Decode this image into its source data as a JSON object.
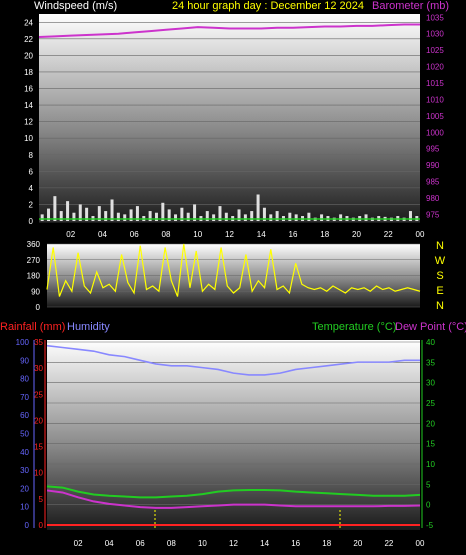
{
  "header": {
    "windspeed_label": "Windspeed (m/s)",
    "title": "24 hour graph day : December 12 2024",
    "barometer_label": "Barometer (mb)"
  },
  "mid_labels": {
    "compass": [
      "N",
      "W",
      "S",
      "E",
      "N"
    ]
  },
  "bottom_header": {
    "rainfall_label": "Rainfall (mm)",
    "humidity_label": "Humidity",
    "temperature_label": "Temperature (°C)",
    "dewpoint_label": "Dew Point (°C)"
  },
  "colors": {
    "windspeed": "#e0e0e0",
    "gust_baseline": "#22cc22",
    "barometer": "#cc33cc",
    "wind_direction": "#ffff00",
    "rainfall": "#ff2222",
    "humidity": "#8888ff",
    "temperature": "#22cc22",
    "dewpoint": "#cc33cc",
    "title": "#ffff00"
  },
  "chart_data": [
    {
      "type": "line",
      "title": "24 hour graph day : December 12 2024",
      "x_ticks": [
        "02",
        "04",
        "06",
        "08",
        "10",
        "12",
        "14",
        "16",
        "18",
        "20",
        "22",
        "00"
      ],
      "xlim": [
        0,
        24
      ],
      "left_axis": {
        "label": "Windspeed (m/s)",
        "ticks": [
          0,
          2,
          4,
          6,
          8,
          10,
          12,
          14,
          16,
          18,
          20,
          22,
          24
        ],
        "ylim": [
          0,
          25
        ]
      },
      "right_axis": {
        "label": "Barometer (mb)",
        "ticks": [
          975,
          980,
          985,
          990,
          995,
          1000,
          1005,
          1010,
          1015,
          1020,
          1025,
          1030,
          1035
        ],
        "ylim": [
          973,
          1036
        ]
      },
      "series": [
        {
          "name": "Windspeed (m/s)",
          "axis": "left",
          "style": "bars",
          "x": [
            0.2,
            0.6,
            1.0,
            1.4,
            1.8,
            2.2,
            2.6,
            3.0,
            3.4,
            3.8,
            4.2,
            4.6,
            5.0,
            5.4,
            5.8,
            6.2,
            6.6,
            7.0,
            7.4,
            7.8,
            8.2,
            8.6,
            9.0,
            9.4,
            9.8,
            10.2,
            10.6,
            11.0,
            11.4,
            11.8,
            12.2,
            12.6,
            13.0,
            13.4,
            13.8,
            14.2,
            14.6,
            15.0,
            15.4,
            15.8,
            16.2,
            16.6,
            17.0,
            17.4,
            17.8,
            18.2,
            18.6,
            19.0,
            19.4,
            19.8,
            20.2,
            20.6,
            21.0,
            21.4,
            21.8,
            22.2,
            22.6,
            23.0,
            23.4,
            23.8
          ],
          "values": [
            0.8,
            1.5,
            3.0,
            1.2,
            2.4,
            1.0,
            2.0,
            1.6,
            0.6,
            1.8,
            1.2,
            2.6,
            1.0,
            0.8,
            1.4,
            1.8,
            0.6,
            1.2,
            1.0,
            2.2,
            1.4,
            0.8,
            1.6,
            1.0,
            2.0,
            0.6,
            1.2,
            0.8,
            1.8,
            1.0,
            0.6,
            1.4,
            0.8,
            1.2,
            3.2,
            1.6,
            0.8,
            1.2,
            0.6,
            1.0,
            0.8,
            0.6,
            1.0,
            0.4,
            0.8,
            0.6,
            0.4,
            0.8,
            0.6,
            0.4,
            0.6,
            0.8,
            0.4,
            0.6,
            0.5,
            0.4,
            0.6,
            0.4,
            1.2,
            0.6
          ]
        },
        {
          "name": "Barometer (mb)",
          "axis": "right",
          "style": "line",
          "x": [
            0,
            1,
            2,
            3,
            4,
            5,
            6,
            7,
            8,
            9,
            10,
            11,
            12,
            13,
            14,
            15,
            16,
            17,
            18,
            19,
            20,
            21,
            22,
            23,
            24
          ],
          "values": [
            1029.0,
            1029.2,
            1029.4,
            1029.6,
            1029.8,
            1030.0,
            1030.4,
            1030.8,
            1031.2,
            1031.6,
            1032.0,
            1031.8,
            1031.6,
            1031.6,
            1031.6,
            1031.8,
            1031.8,
            1032.0,
            1032.2,
            1032.2,
            1032.4,
            1032.4,
            1032.6,
            1032.8,
            1032.8
          ]
        }
      ]
    },
    {
      "type": "line",
      "x_ticks": [
        "02",
        "04",
        "06",
        "08",
        "10",
        "12",
        "14",
        "16",
        "18",
        "20",
        "22",
        "00"
      ],
      "xlim": [
        0,
        24
      ],
      "left_axis": {
        "ticks": [
          0,
          90,
          180,
          270,
          360
        ],
        "ylim": [
          0,
          360
        ]
      },
      "right_labels": [
        "N",
        "W",
        "S",
        "E",
        "N"
      ],
      "series": [
        {
          "name": "Wind direction",
          "axis": "left",
          "style": "line",
          "x": [
            0,
            0.4,
            0.8,
            1.2,
            1.6,
            2.0,
            2.4,
            2.8,
            3.2,
            3.6,
            4.0,
            4.4,
            4.8,
            5.2,
            5.6,
            6.0,
            6.4,
            6.8,
            7.2,
            7.6,
            8.0,
            8.4,
            8.8,
            9.2,
            9.6,
            10.0,
            10.4,
            10.8,
            11.2,
            11.6,
            12.0,
            12.4,
            12.8,
            13.2,
            13.6,
            14.0,
            14.4,
            14.8,
            15.2,
            15.6,
            16.0,
            16.4,
            16.8,
            17.2,
            17.6,
            18.0,
            18.4,
            18.8,
            19.2,
            19.6,
            20.0,
            20.4,
            20.8,
            21.2,
            21.6,
            22.0,
            22.4,
            22.8,
            23.2,
            23.6,
            24.0
          ],
          "values": [
            100,
            340,
            60,
            150,
            90,
            310,
            120,
            80,
            200,
            110,
            130,
            90,
            300,
            140,
            80,
            350,
            100,
            120,
            90,
            340,
            150,
            60,
            360,
            110,
            320,
            90,
            130,
            100,
            340,
            120,
            80,
            110,
            300,
            90,
            150,
            110,
            330,
            100,
            120,
            80,
            250,
            130,
            110,
            100,
            110,
            90,
            120,
            100,
            80,
            110,
            100,
            110,
            90,
            120,
            100,
            110,
            90,
            100,
            110,
            100,
            90
          ]
        }
      ]
    },
    {
      "type": "line",
      "x_ticks": [
        "02",
        "04",
        "06",
        "08",
        "10",
        "12",
        "14",
        "16",
        "18",
        "20",
        "22",
        "00"
      ],
      "xlim": [
        0,
        24
      ],
      "far_left_axis": {
        "label": "Humidity",
        "ticks": [
          0,
          10,
          20,
          30,
          40,
          50,
          60,
          70,
          80,
          90,
          100
        ],
        "ylim": [
          0,
          100
        ]
      },
      "left_axis": {
        "label": "Rainfall (mm)",
        "ticks": [
          0,
          5,
          10,
          15,
          20,
          25,
          30,
          35
        ],
        "ylim": [
          0,
          35
        ]
      },
      "right_axis": {
        "label": "Temperature (°C)",
        "ticks": [
          -5,
          0,
          5,
          10,
          15,
          20,
          25,
          30,
          35,
          40
        ],
        "ylim": [
          -5,
          40
        ]
      },
      "series": [
        {
          "name": "Humidity",
          "axis": "far_left",
          "style": "line",
          "x": [
            0,
            1,
            2,
            3,
            4,
            5,
            6,
            7,
            8,
            9,
            10,
            11,
            12,
            13,
            14,
            15,
            16,
            17,
            18,
            19,
            20,
            21,
            22,
            23,
            24
          ],
          "values": [
            98,
            97,
            96,
            95,
            93,
            92,
            90,
            88,
            87,
            87,
            86,
            85,
            83,
            82,
            82,
            83,
            85,
            86,
            87,
            88,
            89,
            89,
            89,
            90,
            90
          ]
        },
        {
          "name": "Rainfall (mm)",
          "axis": "left",
          "style": "line",
          "x": [
            0,
            24
          ],
          "values": [
            0,
            0
          ]
        },
        {
          "name": "Temperature (°C)",
          "axis": "right",
          "style": "line",
          "x": [
            0,
            1,
            2,
            3,
            4,
            5,
            6,
            7,
            8,
            9,
            10,
            11,
            12,
            13,
            14,
            15,
            16,
            17,
            18,
            19,
            20,
            21,
            22,
            23,
            24
          ],
          "values": [
            4.5,
            4.2,
            3.2,
            2.5,
            2.2,
            2.0,
            1.8,
            1.8,
            2.0,
            2.2,
            2.6,
            3.2,
            3.5,
            3.6,
            3.6,
            3.5,
            3.2,
            3.0,
            2.8,
            2.6,
            2.4,
            2.2,
            2.2,
            2.2,
            2.4
          ]
        },
        {
          "name": "Dew Point (°C)",
          "axis": "right",
          "style": "line",
          "x": [
            0,
            1,
            2,
            3,
            4,
            5,
            6,
            7,
            8,
            9,
            10,
            11,
            12,
            13,
            14,
            15,
            16,
            17,
            18,
            19,
            20,
            21,
            22,
            23,
            24
          ],
          "values": [
            3.5,
            3.0,
            1.8,
            0.8,
            0.2,
            -0.2,
            -0.6,
            -0.8,
            -0.8,
            -0.6,
            -0.4,
            -0.2,
            0.0,
            0.0,
            0.0,
            -0.2,
            -0.4,
            -0.4,
            -0.4,
            -0.4,
            -0.4,
            -0.4,
            -0.3,
            -0.3,
            -0.2
          ]
        }
      ]
    }
  ]
}
